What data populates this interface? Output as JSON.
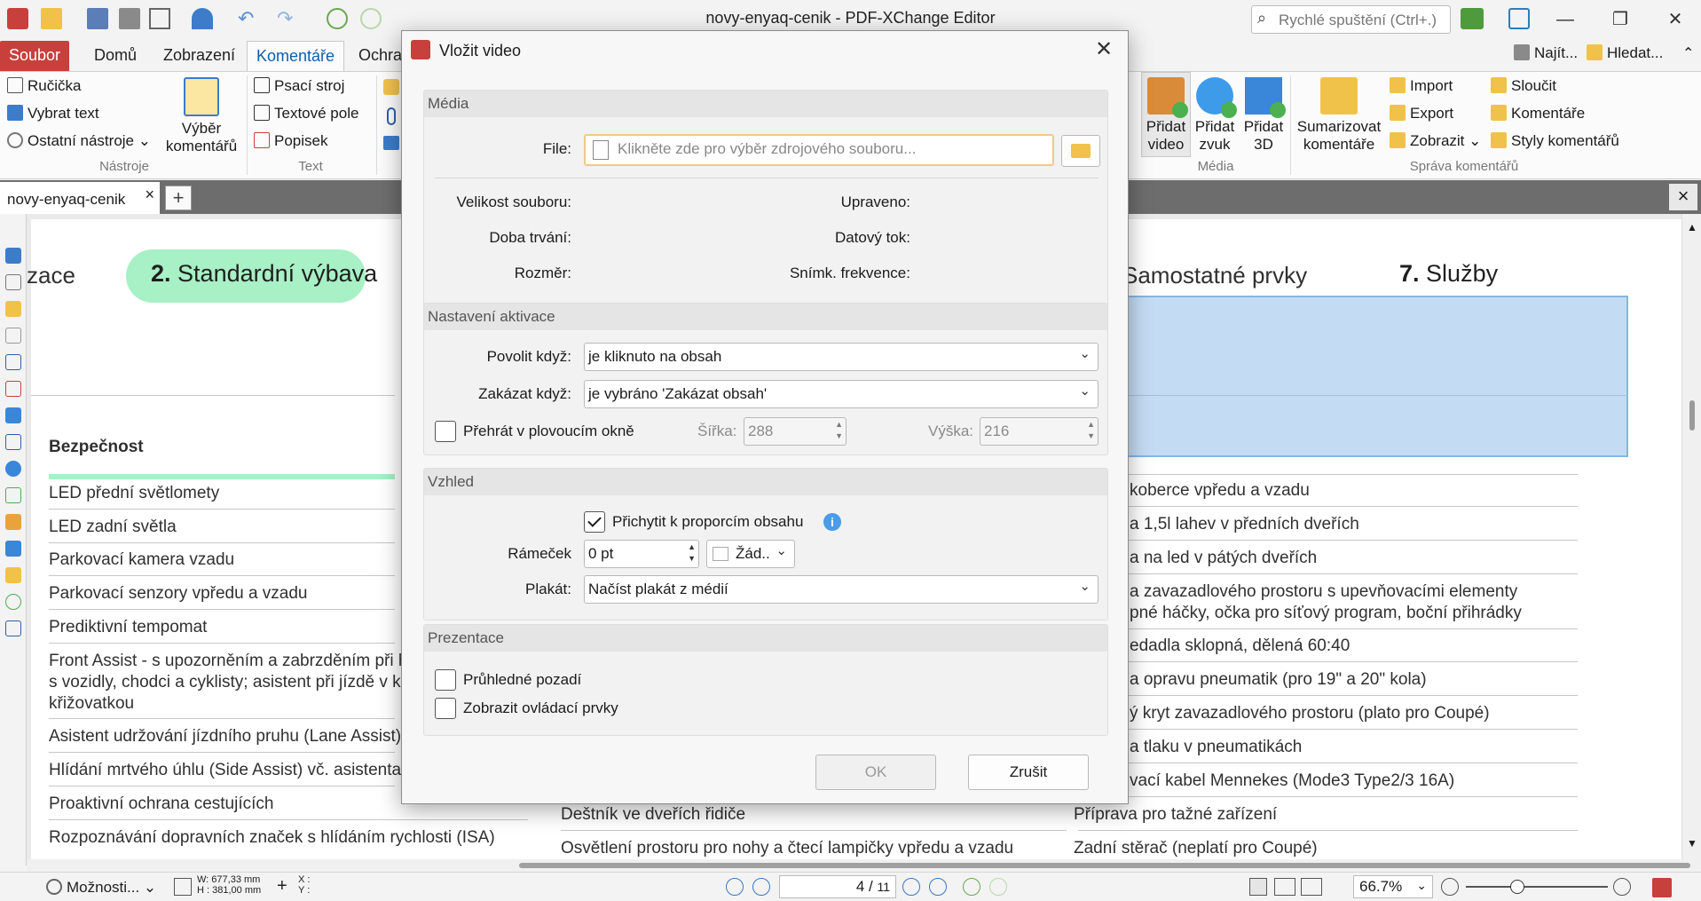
{
  "app": {
    "title": "novy-enyaq-cenik - PDF-XChange Editor",
    "quick_search_placeholder": "Rychlé spuštění (Ctrl+.)",
    "find_label": "Najít...",
    "search_label": "Hledat..."
  },
  "menu": {
    "tabs": [
      "Soubor",
      "Domů",
      "Zobrazení",
      "Komentáře",
      "Ochra"
    ]
  },
  "ribbon": {
    "tools": {
      "items": [
        "Ručička",
        "Vybrat text",
        "Ostatní nástroje"
      ],
      "group": "Nástroje"
    },
    "select_comments": [
      "Výběr",
      "komentářů"
    ],
    "text": {
      "items": [
        "Psací stroj",
        "Textové pole",
        "Popisek"
      ],
      "group": "Text"
    },
    "media": {
      "items": [
        {
          "line1": "Přidat",
          "line2": "video"
        },
        {
          "line1": "Přidat",
          "line2": "zvuk"
        },
        {
          "line1": "Přidat",
          "line2": "3D"
        }
      ],
      "group": "Média"
    },
    "manage": {
      "summarize": [
        "Sumarizovat",
        "komentáře"
      ],
      "col1": [
        "Import",
        "Export",
        "Zobrazit"
      ],
      "col2": [
        "Sloučit",
        "Komentáře",
        "Styly komentářů"
      ],
      "group": "Správa komentářů"
    }
  },
  "doc_tab": {
    "name": "novy-enyaq-cenik"
  },
  "pdf": {
    "header_left": "zace",
    "header_pill_num": "2.",
    "header_pill_text": "Standardní výbava",
    "header_right": "Samostatné prvky",
    "header_services_num": "7.",
    "header_services_text": "Služby",
    "section_title": "Bezpečnost",
    "left_items": [
      "LED přední světlomety",
      "LED zadní světla",
      "Parkovací kamera vzadu",
      "Parkovací senzory vpředu a vzadu",
      "Prediktivní tempomat",
      "Front Assist - s upozorněním a zabrzděním při h",
      "s vozidly, chodci a cyklisty; asistent při jízdě v ko",
      "křižovatkou",
      "Asistent udržování jízdního pruhu (Lane Assist)",
      "Hlídání mrtvého úhlu (Side Assist) vč. asistenta",
      "Proaktivní ochrana cestujících",
      "Rozpoznávání dopravních značek s hlídáním rychlosti (ISA)"
    ],
    "mid_items": [
      "Deštník ve dveřích řidiče",
      "Osvětlení prostoru pro nohy a čtecí lampičky vpředu a vzadu"
    ],
    "right_items": [
      "koberce vpředu a vzadu",
      "a 1,5l lahev v předních dveřích",
      "a na led v pátých dveřích",
      "a zavazadlového prostoru s upevňovacími elementy",
      "pné háčky, očka pro síťový program, boční přihrádky",
      "edadla sklopná, dělená 60:40",
      "a opravu pneumatik (pro 19\" a 20\" kola)",
      "ý kryt zavazadlového prostoru (plato pro Coupé)",
      "a tlaku v pneumatikách",
      "vací kabel Mennekes (Mode3 Type2/3 16A)",
      "Příprava pro tažné zařízení",
      "Zadní stěrač (neplatí pro Coupé)"
    ]
  },
  "status": {
    "options_label": "Možnosti...",
    "w_label": "W: 677,33 mm",
    "h_label": "H : 381,00 mm",
    "x_label": "X :",
    "y_label": "Y :",
    "page_current": "4",
    "page_total": "11",
    "zoom": "66.7%"
  },
  "dialog": {
    "title": "Vložit video",
    "media": {
      "head": "Média",
      "file_label": "File:",
      "file_placeholder": "Klikněte zde pro výběr zdrojového souboru...",
      "size_label": "Velikost souboru:",
      "modified_label": "Upraveno:",
      "duration_label": "Doba trvání:",
      "bitrate_label": "Datový tok:",
      "dimension_label": "Rozměr:",
      "framerate_label": "Snímk. frekvence:"
    },
    "activation": {
      "head": "Nastavení aktivace",
      "enable_label": "Povolit když:",
      "enable_value": "je kliknuto na obsah",
      "disable_label": "Zakázat když:",
      "disable_value": "je vybráno 'Zakázat obsah'",
      "floating_label": "Přehrát v plovoucím okně",
      "floating_checked": false,
      "width_label": "Šířka:",
      "width_value": "288",
      "height_label": "Výška:",
      "height_value": "216"
    },
    "appearance": {
      "head": "Vzhled",
      "snap_label": "Přichytit k proporcím obsahu",
      "snap_checked": true,
      "border_label": "Rámeček",
      "border_value": "0 pt",
      "border_color_value": "Žád..",
      "poster_label": "Plakát:",
      "poster_value": "Načíst plakát z médií"
    },
    "presentation": {
      "head": "Prezentace",
      "transparent_label": "Průhledné pozadí",
      "transparent_checked": false,
      "controls_label": "Zobrazit ovládací prvky",
      "controls_checked": false
    },
    "ok_label": "OK",
    "cancel_label": "Zrušit"
  },
  "colors": {
    "accent_red": "#c8403c",
    "tab_active_text": "#0a5fb0",
    "pill_green": "#a8f0c5",
    "selection_blue": "#c4dcf3"
  }
}
